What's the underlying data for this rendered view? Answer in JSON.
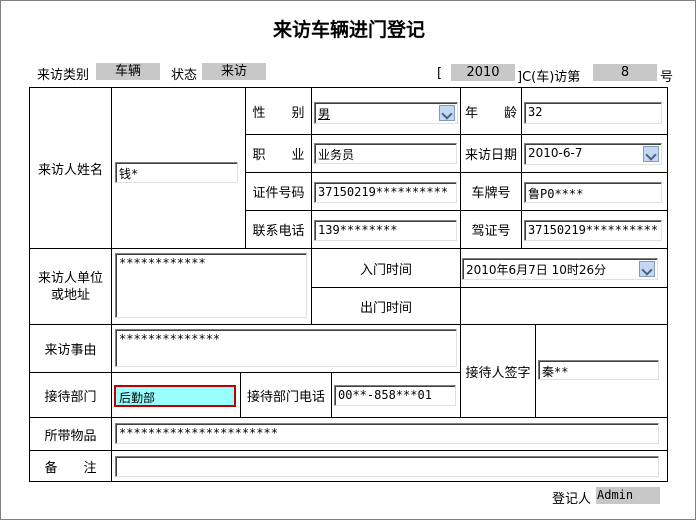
{
  "title": "来访车辆进门登记",
  "header": {
    "category_label": "来访类别",
    "category_value": "车辆",
    "status_label": "状态",
    "status_value": "来访",
    "bracket_open": "[",
    "year_value": "2010",
    "record_middle": "]C(车)访第",
    "number_value": "8",
    "number_suffix": "号"
  },
  "visitor": {
    "name_label": "来访人姓名",
    "name_value": "钱*",
    "gender_label": "性　　别",
    "gender_value": "男",
    "age_label": "年　　龄",
    "age_value": "32",
    "job_label": "职　　业",
    "job_value": "业务员",
    "visit_date_label": "来访日期",
    "visit_date_value": "2010-6-7",
    "id_label": "证件号码",
    "id_value": "37150219**********",
    "plate_label": "车牌号",
    "plate_value": "鲁P0****",
    "phone_label": "联系电话",
    "phone_value": "139********",
    "license_label": "驾证号",
    "license_value": "37150219**********"
  },
  "org": {
    "label": "来访人单位\n或地址",
    "value": "************",
    "enter_time_label": "入门时间",
    "enter_time_value": "2010年6月7日  10时26分",
    "exit_time_label": "出门时间",
    "exit_time_value": ""
  },
  "reason": {
    "label": "来访事由",
    "value": "**************"
  },
  "reception": {
    "dept_label": "接待部门",
    "dept_value": "后勤部",
    "dept_phone_label": "接待部门电话",
    "dept_phone_value": "00**-858***01",
    "signer_label": "接待人签字",
    "signer_value": "秦**"
  },
  "items": {
    "label": "所带物品",
    "value": "**********************"
  },
  "remarks": {
    "label": "备　　注",
    "value": ""
  },
  "footer": {
    "registrar_label": "登记人",
    "registrar_value": "Admin"
  },
  "colors": {
    "highlight_field": "#99ffff",
    "highlight_border": "#c00000",
    "grey_field": "#c8c8c8"
  }
}
